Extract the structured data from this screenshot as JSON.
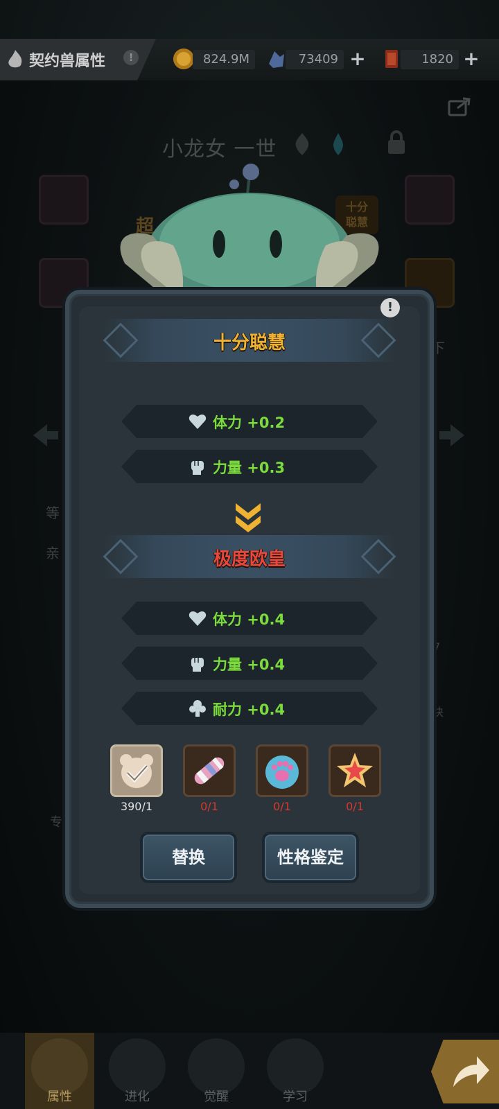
{
  "topbar": {
    "title": "契约兽属性",
    "title_alert": "!",
    "gold": "824.9M",
    "crystal": "73409",
    "ticket": "1820",
    "plus": "+"
  },
  "background": {
    "pet_name": "小龙女 一世",
    "side_tag_right": "十分\n聪慧",
    "side_tag_left": "超",
    "right_cutoff_btn": "下",
    "label_1": "等",
    "label_2": "亲",
    "stat_edge": ".7",
    "stat_edge_2": "块",
    "skill_edge": "专"
  },
  "modal": {
    "info": "!",
    "current_title": "十分聪慧",
    "current_title_color": "#f0b232",
    "current_stats": [
      {
        "icon": "heart-icon",
        "text": "体力 +0.2"
      },
      {
        "icon": "fist-icon",
        "text": "力量 +0.3"
      }
    ],
    "new_title": "极度欧皇",
    "new_title_color": "#e8483c",
    "new_stats": [
      {
        "icon": "heart-icon",
        "text": "体力 +0.4"
      },
      {
        "icon": "fist-icon",
        "text": "力量 +0.4"
      },
      {
        "icon": "endurance-icon",
        "text": "耐力 +0.4"
      }
    ],
    "items": [
      {
        "icon": "bear-token-icon",
        "count": "390/1",
        "selected": true
      },
      {
        "icon": "candy-icon",
        "count": "0/1",
        "selected": false
      },
      {
        "icon": "paw-gem-icon",
        "count": "0/1",
        "selected": false
      },
      {
        "icon": "star-icon",
        "count": "0/1",
        "selected": false
      }
    ],
    "btn_replace": "替换",
    "btn_identify": "性格鉴定"
  },
  "nav": {
    "tabs": [
      "属性",
      "进化",
      "觉醒",
      "学习"
    ],
    "active": "属性"
  }
}
